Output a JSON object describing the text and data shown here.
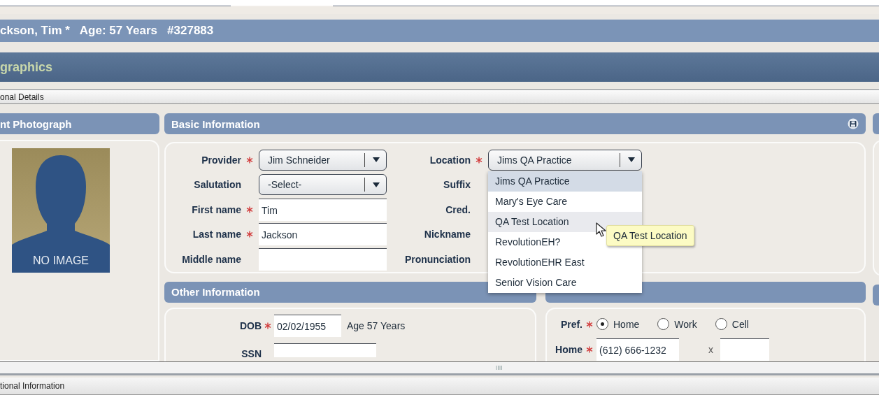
{
  "patient_header": {
    "name": "ckson, Tim *",
    "age": "Age: 57 Years",
    "record_number": "#327883"
  },
  "section_title": "graphics",
  "subsection": "onal Details",
  "photo_panel": {
    "title": "nt Photograph",
    "image_text": "NO IMAGE"
  },
  "basic_information": {
    "title": "Basic Information",
    "left_fields": [
      {
        "label": "Provider",
        "required": true,
        "kind": "select",
        "value": "Jim Schneider"
      },
      {
        "label": "Salutation",
        "required": false,
        "kind": "select",
        "value": "-Select-"
      },
      {
        "label": "First name",
        "required": true,
        "kind": "text",
        "value": "Tim"
      },
      {
        "label": "Last name",
        "required": true,
        "kind": "text",
        "value": "Jackson"
      },
      {
        "label": "Middle name",
        "required": false,
        "kind": "text"
      }
    ],
    "right_fields": [
      {
        "label": "Location",
        "required": true,
        "kind": "select",
        "value": "Jims QA Practice",
        "expanded": true
      },
      {
        "label": "Suffix",
        "required": false
      },
      {
        "label": "Cred.",
        "required": false
      },
      {
        "label": "Nickname",
        "required": false
      },
      {
        "label": "Pronunciation",
        "required": false
      }
    ],
    "location_options": [
      {
        "label": "Jims QA Practice",
        "selected": true,
        "hovered": false
      },
      {
        "label": "Mary's Eye Care",
        "selected": false,
        "hovered": false
      },
      {
        "label": "QA Test Location",
        "selected": false,
        "hovered": true
      },
      {
        "label": "RevolutionEH?",
        "selected": false,
        "hovered": false
      },
      {
        "label": "RevolutionEHR East",
        "selected": false,
        "hovered": false
      },
      {
        "label": "Senior Vision Care",
        "selected": false,
        "hovered": false
      }
    ],
    "tooltip": "QA Test Location"
  },
  "other_information": {
    "title": "Other Information",
    "dob_label": "DOB",
    "dob_required": true,
    "dob": "02/02/1955",
    "age": "Age 57 Years",
    "ssn_label": "SSN"
  },
  "contact": {
    "pref_label": "Pref.",
    "pref_required": true,
    "pref_options": [
      {
        "label": "Home",
        "selected": true
      },
      {
        "label": "Work",
        "selected": false
      },
      {
        "label": "Cell",
        "selected": false
      }
    ],
    "phone_label": "Home",
    "phone_required": true,
    "phone": "(612) 666-1232",
    "ext_label": "x"
  },
  "bottom_bar": "tional Information"
}
